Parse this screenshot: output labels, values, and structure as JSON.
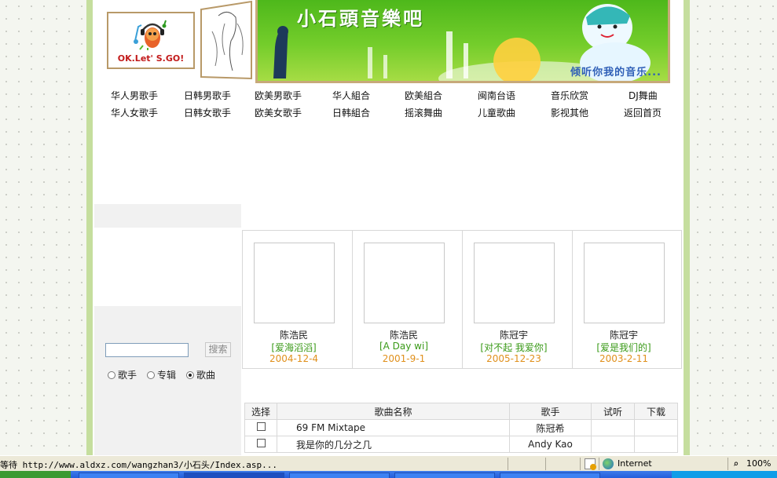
{
  "header": {
    "logo_text": "OK.Let' S.GO!",
    "banner_title": "小石頭音樂吧",
    "banner_slogan": "倾听你我的音乐..."
  },
  "nav": {
    "row1": [
      "华人男歌手",
      "日韩男歌手",
      "欧美男歌手",
      "华人組合",
      "欧美組合",
      "闽南台语",
      "音乐欣赏",
      "DJ舞曲"
    ],
    "row2": [
      "华人女歌手",
      "日韩女歌手",
      "欧美女歌手",
      "日韩組合",
      "摇滚舞曲",
      "儿童歌曲",
      "影视其他",
      "返回首页"
    ]
  },
  "search": {
    "input_value": "",
    "button_label": "搜索",
    "options": [
      "歌手",
      "专辑",
      "歌曲"
    ],
    "selected": "歌曲"
  },
  "albums": [
    {
      "artist": "陈浩民",
      "name": "[爱海滔滔]",
      "date": "2004-12-4"
    },
    {
      "artist": "陈浩民",
      "name": "[A Day wi]",
      "date": "2001-9-1"
    },
    {
      "artist": "陈冠宇",
      "name": "[对不起 我爱你]",
      "date": "2005-12-23"
    },
    {
      "artist": "陈冠宇",
      "name": "[爱是我们的]",
      "date": "2003-2-11"
    }
  ],
  "songs": {
    "headers": [
      "选择",
      "歌曲名称",
      "歌手",
      "试听",
      "下载"
    ],
    "rows": [
      {
        "name": "69 FM Mixtape",
        "singer": "陈冠希"
      },
      {
        "name": "我是你的几分之几",
        "singer": "Andy Kao"
      }
    ]
  },
  "statusbar": {
    "text": "等待 http://www.aldxz.com/wangzhan3/小石头/Index.asp...",
    "zone": "Internet",
    "zoom": "100%"
  },
  "colors": {
    "frame": "#c5de9e",
    "banner_green": "#5cbf22",
    "album_name": "#3a9a18",
    "album_date": "#e0901c"
  }
}
